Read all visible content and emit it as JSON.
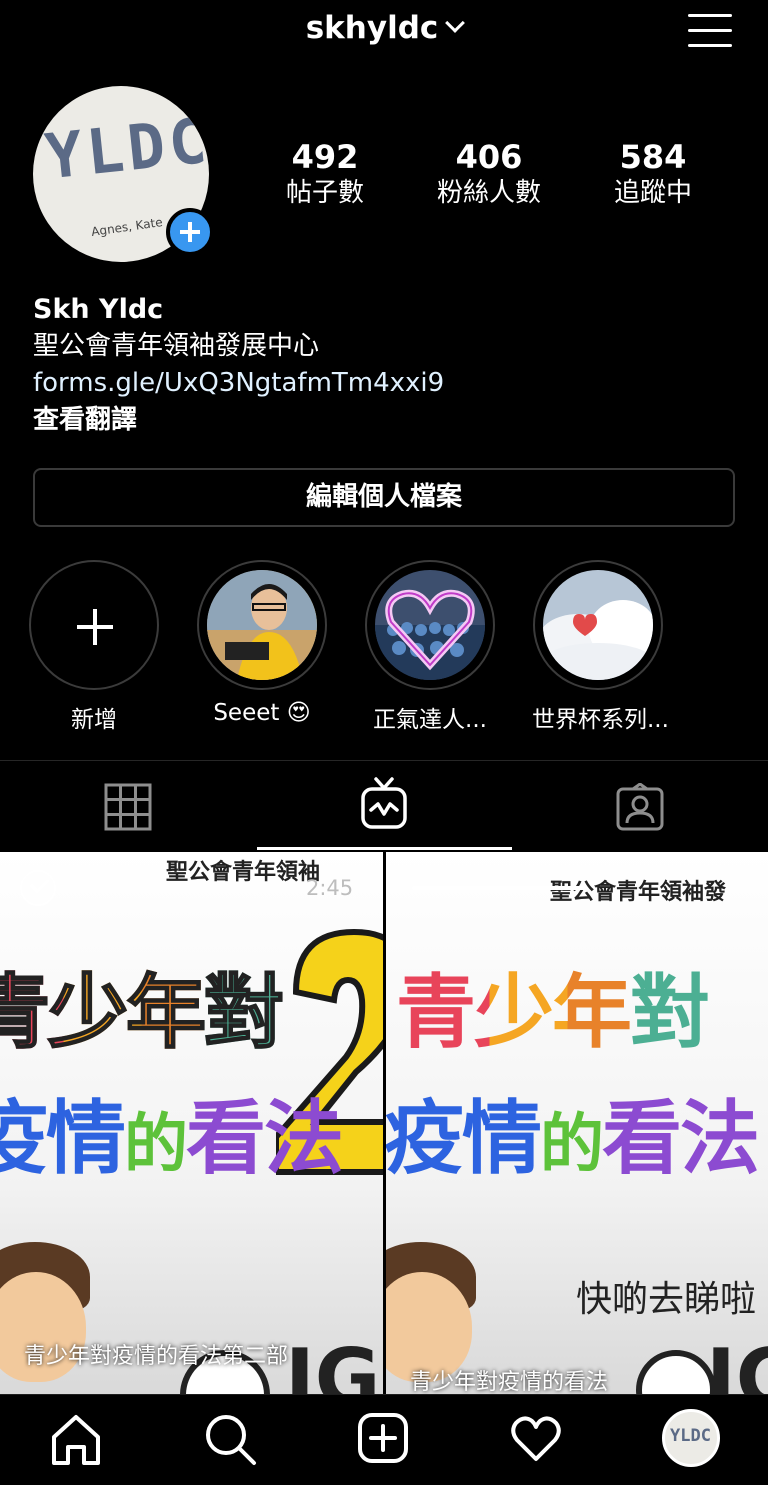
{
  "header": {
    "username": "skhyldc"
  },
  "profile": {
    "avatar_text": "YLDC",
    "avatar_subtext": "Agnes, Kate",
    "stats": [
      {
        "value": "492",
        "label": "帖子數"
      },
      {
        "value": "406",
        "label": "粉絲人數"
      },
      {
        "value": "584",
        "label": "追蹤中"
      }
    ],
    "name": "Skh Yldc",
    "bio": "聖公會青年領袖發展中心",
    "link": "forms.gle/UxQ3NgtafmTm4xxi9",
    "translate": "查看翻譯",
    "edit_button": "編輯個人檔案"
  },
  "highlights": [
    {
      "label": "新增"
    },
    {
      "label": "Seeet 😍"
    },
    {
      "label": "正氣達人..."
    },
    {
      "label": "世界杯系列..."
    }
  ],
  "videos": [
    {
      "header_text": "聖公會青年領袖",
      "duration": "2:45",
      "title_line1": "青少年對",
      "title_line2a": "疫情",
      "title_line2b": "的",
      "title_line2c": "看法",
      "caption": "青少年對疫情的看法第二部",
      "big_number": "2"
    },
    {
      "header_text": "聖公會青年領袖發",
      "title_line1": "青少年對",
      "title_line2a": "疫情",
      "title_line2b": "的",
      "title_line2c": "看法",
      "side_text": "快啲去睇啦",
      "caption": "青少年對疫情的看法"
    }
  ],
  "colors": {
    "accent": "#3897f0",
    "background": "#000000"
  }
}
